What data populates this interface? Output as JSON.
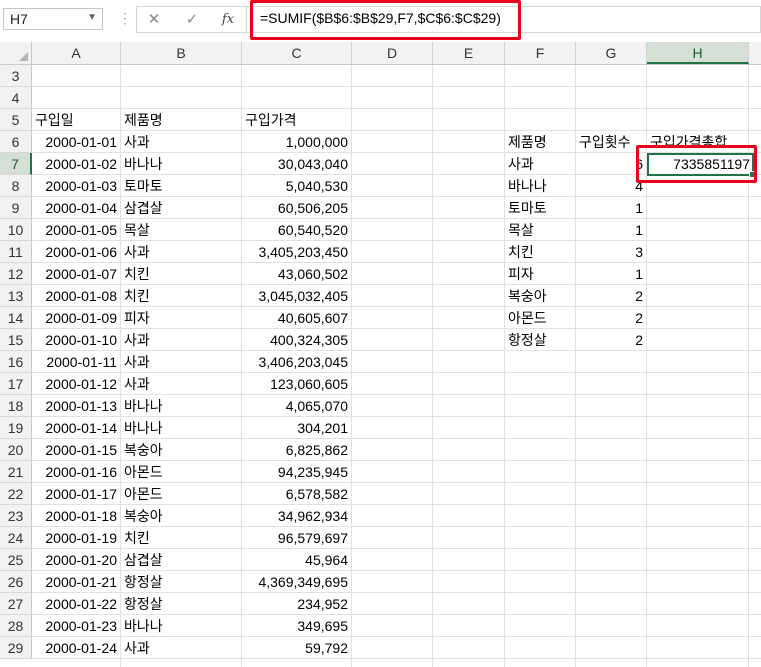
{
  "name_box": {
    "value": "H7"
  },
  "formula_bar": {
    "cancel_icon": "close-icon",
    "enter_icon": "check-icon",
    "fx_label": "fx",
    "formula": "=SUMIF($B$6:$B$29,F7,$C$6:$C$29)"
  },
  "columns": [
    "A",
    "B",
    "C",
    "D",
    "E",
    "F",
    "G",
    "H"
  ],
  "rows": [
    "3",
    "4",
    "5",
    "6",
    "7",
    "8",
    "9",
    "10",
    "11",
    "12",
    "13",
    "14",
    "15",
    "16",
    "17",
    "18",
    "19",
    "20",
    "21",
    "22",
    "23",
    "24",
    "25",
    "26",
    "27",
    "28",
    "29"
  ],
  "selected_cell": {
    "column": "H",
    "row": "7"
  },
  "headers": {
    "date": "구입일",
    "product": "제품명",
    "price": "구입가격"
  },
  "purchases": [
    {
      "date": "2000-01-01",
      "product": "사과",
      "price": "1,000,000"
    },
    {
      "date": "2000-01-02",
      "product": "바나나",
      "price": "30,043,040"
    },
    {
      "date": "2000-01-03",
      "product": "토마토",
      "price": "5,040,530"
    },
    {
      "date": "2000-01-04",
      "product": "삼겹살",
      "price": "60,506,205"
    },
    {
      "date": "2000-01-05",
      "product": "목살",
      "price": "60,540,520"
    },
    {
      "date": "2000-01-06",
      "product": "사과",
      "price": "3,405,203,450"
    },
    {
      "date": "2000-01-07",
      "product": "치킨",
      "price": "43,060,502"
    },
    {
      "date": "2000-01-08",
      "product": "치킨",
      "price": "3,045,032,405"
    },
    {
      "date": "2000-01-09",
      "product": "피자",
      "price": "40,605,607"
    },
    {
      "date": "2000-01-10",
      "product": "사과",
      "price": "400,324,305"
    },
    {
      "date": "2000-01-11",
      "product": "사과",
      "price": "3,406,203,045"
    },
    {
      "date": "2000-01-12",
      "product": "사과",
      "price": "123,060,605"
    },
    {
      "date": "2000-01-13",
      "product": "바나나",
      "price": "4,065,070"
    },
    {
      "date": "2000-01-14",
      "product": "바나나",
      "price": "304,201"
    },
    {
      "date": "2000-01-15",
      "product": "복숭아",
      "price": "6,825,862"
    },
    {
      "date": "2000-01-16",
      "product": "아몬드",
      "price": "94,235,945"
    },
    {
      "date": "2000-01-17",
      "product": "아몬드",
      "price": "6,578,582"
    },
    {
      "date": "2000-01-18",
      "product": "복숭아",
      "price": "34,962,934"
    },
    {
      "date": "2000-01-19",
      "product": "치킨",
      "price": "96,579,697"
    },
    {
      "date": "2000-01-20",
      "product": "삼겹살",
      "price": "45,964"
    },
    {
      "date": "2000-01-21",
      "product": "항정살",
      "price": "4,369,349,695"
    },
    {
      "date": "2000-01-22",
      "product": "항정살",
      "price": "234,952"
    },
    {
      "date": "2000-01-23",
      "product": "바나나",
      "price": "349,695"
    },
    {
      "date": "2000-01-24",
      "product": "사과",
      "price": "59,792"
    }
  ],
  "summary": {
    "headers": {
      "product": "제품명",
      "count": "구입횟수",
      "total": "구입가격총합"
    },
    "rows": [
      {
        "product": "사과",
        "count": "6",
        "total": "7335851197"
      },
      {
        "product": "바나나",
        "count": "4",
        "total": ""
      },
      {
        "product": "토마토",
        "count": "1",
        "total": ""
      },
      {
        "product": "목살",
        "count": "1",
        "total": ""
      },
      {
        "product": "치킨",
        "count": "3",
        "total": ""
      },
      {
        "product": "피자",
        "count": "1",
        "total": ""
      },
      {
        "product": "복숭아",
        "count": "2",
        "total": ""
      },
      {
        "product": "아몬드",
        "count": "2",
        "total": ""
      },
      {
        "product": "항정살",
        "count": "2",
        "total": ""
      }
    ]
  },
  "colors": {
    "selection": "#217346",
    "highlight": "#e8001c",
    "header_bg": "#f2f2f2"
  }
}
